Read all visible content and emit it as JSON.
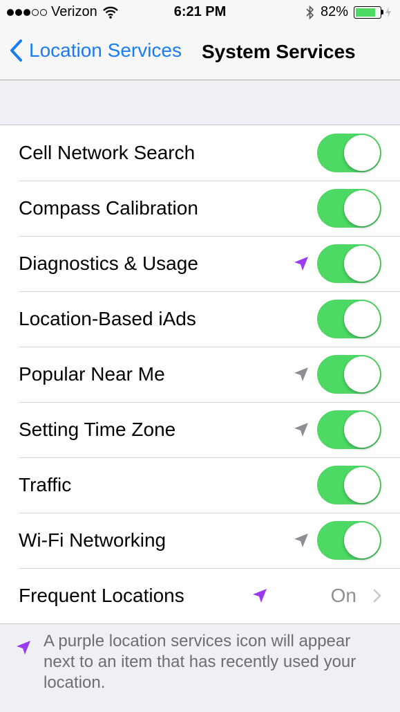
{
  "status_bar": {
    "carrier": "Verizon",
    "time": "6:21 PM",
    "battery_percent": "82%",
    "battery_level": 0.82,
    "signal_bars_filled": 3,
    "signal_bars_total": 5
  },
  "nav": {
    "back_label": "Location Services",
    "title": "System Services"
  },
  "colors": {
    "toggle_on": "#4cd964",
    "accent_blue": "#1a7cf3",
    "purple_arrow": "#9b3bf0",
    "gray_arrow": "#8e8e93"
  },
  "rows": [
    {
      "label": "Cell Network Search",
      "toggle": true,
      "arrow": null
    },
    {
      "label": "Compass Calibration",
      "toggle": true,
      "arrow": null
    },
    {
      "label": "Diagnostics & Usage",
      "toggle": true,
      "arrow": "purple"
    },
    {
      "label": "Location-Based iAds",
      "toggle": true,
      "arrow": null
    },
    {
      "label": "Popular Near Me",
      "toggle": true,
      "arrow": "gray"
    },
    {
      "label": "Setting Time Zone",
      "toggle": true,
      "arrow": "gray"
    },
    {
      "label": "Traffic",
      "toggle": true,
      "arrow": null
    },
    {
      "label": "Wi-Fi Networking",
      "toggle": true,
      "arrow": "gray"
    }
  ],
  "frequent_locations": {
    "label": "Frequent Locations",
    "value": "On",
    "arrow": "purple"
  },
  "footer": {
    "purple_note": "A purple location services icon will appear next to an item that has recently used your location."
  }
}
